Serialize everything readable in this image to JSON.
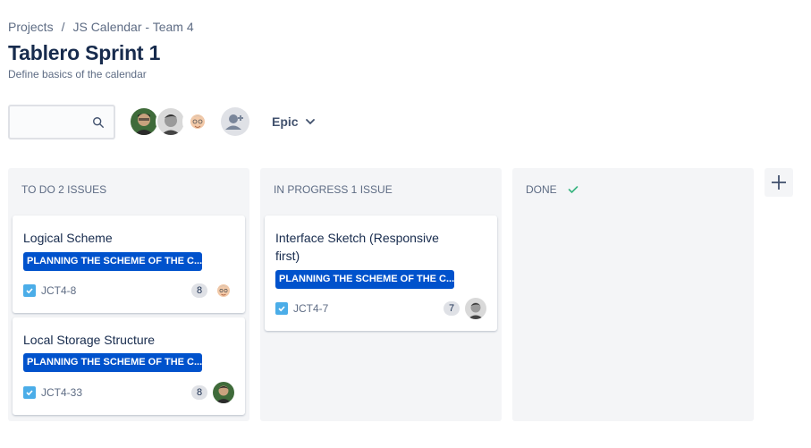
{
  "breadcrumb": {
    "items": [
      "Projects",
      "JS Calendar - Team 4"
    ],
    "separator": "/"
  },
  "page": {
    "title": "Tablero Sprint 1",
    "subtitle": "Define basics of the calendar"
  },
  "toolbar": {
    "search_placeholder": "",
    "epic_label": "Epic"
  },
  "colors": {
    "epic_tag": "#0052cc",
    "task_icon": "#4bade8",
    "done_check": "#36b37e",
    "column_bg": "#f4f5f7"
  },
  "columns": [
    {
      "header": "TO DO 2 ISSUES",
      "cards": [
        {
          "title": "Logical Scheme",
          "epic": "PLANNING THE SCHEME OF THE C...",
          "key": "JCT4-8",
          "points": "8",
          "assignee_icon": "avatar-memoji"
        },
        {
          "title": "Local Storage Structure",
          "epic": "PLANNING THE SCHEME OF THE C...",
          "key": "JCT4-33",
          "points": "8",
          "assignee_icon": "avatar-photo-green"
        }
      ]
    },
    {
      "header": "IN PROGRESS 1 ISSUE",
      "cards": [
        {
          "title": "Interface Sketch (Responsive first)",
          "epic": "PLANNING THE SCHEME OF THE C...",
          "key": "JCT4-7",
          "points": "7",
          "assignee_icon": "avatar-photo-bw"
        }
      ]
    },
    {
      "header": "DONE",
      "cards": []
    }
  ]
}
